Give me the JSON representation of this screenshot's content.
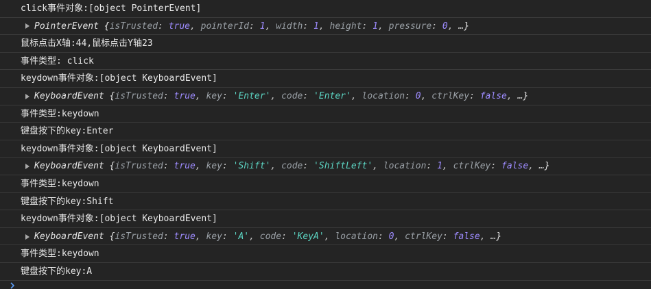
{
  "rows": [
    {
      "type": "text",
      "text": "click事件对象:[object PointerEvent]"
    },
    {
      "type": "object",
      "name": "PointerEvent",
      "props": [
        {
          "key": "isTrusted",
          "value": "true",
          "kind": "bool"
        },
        {
          "key": "pointerId",
          "value": "1",
          "kind": "num"
        },
        {
          "key": "width",
          "value": "1",
          "kind": "num"
        },
        {
          "key": "height",
          "value": "1",
          "kind": "num"
        },
        {
          "key": "pressure",
          "value": "0",
          "kind": "num"
        }
      ],
      "ellipsis": "…"
    },
    {
      "type": "text",
      "text": "鼠标点击X轴:44,鼠标点击Y轴23"
    },
    {
      "type": "text",
      "text": "事件类型: click"
    },
    {
      "type": "text",
      "text": "keydown事件对象:[object KeyboardEvent]"
    },
    {
      "type": "object",
      "name": "KeyboardEvent",
      "props": [
        {
          "key": "isTrusted",
          "value": "true",
          "kind": "bool"
        },
        {
          "key": "key",
          "value": "'Enter'",
          "kind": "str"
        },
        {
          "key": "code",
          "value": "'Enter'",
          "kind": "str"
        },
        {
          "key": "location",
          "value": "0",
          "kind": "num"
        },
        {
          "key": "ctrlKey",
          "value": "false",
          "kind": "bool"
        }
      ],
      "ellipsis": "…"
    },
    {
      "type": "text",
      "text": "事件类型:keydown"
    },
    {
      "type": "text",
      "text": "键盘按下的key:Enter"
    },
    {
      "type": "text",
      "text": "keydown事件对象:[object KeyboardEvent]"
    },
    {
      "type": "object",
      "name": "KeyboardEvent",
      "props": [
        {
          "key": "isTrusted",
          "value": "true",
          "kind": "bool"
        },
        {
          "key": "key",
          "value": "'Shift'",
          "kind": "str"
        },
        {
          "key": "code",
          "value": "'ShiftLeft'",
          "kind": "str"
        },
        {
          "key": "location",
          "value": "1",
          "kind": "num"
        },
        {
          "key": "ctrlKey",
          "value": "false",
          "kind": "bool"
        }
      ],
      "ellipsis": "…"
    },
    {
      "type": "text",
      "text": "事件类型:keydown"
    },
    {
      "type": "text",
      "text": "键盘按下的key:Shift"
    },
    {
      "type": "text",
      "text": "keydown事件对象:[object KeyboardEvent]"
    },
    {
      "type": "object",
      "name": "KeyboardEvent",
      "props": [
        {
          "key": "isTrusted",
          "value": "true",
          "kind": "bool"
        },
        {
          "key": "key",
          "value": "'A'",
          "kind": "str"
        },
        {
          "key": "code",
          "value": "'KeyA'",
          "kind": "str"
        },
        {
          "key": "location",
          "value": "0",
          "kind": "num"
        },
        {
          "key": "ctrlKey",
          "value": "false",
          "kind": "bool"
        }
      ],
      "ellipsis": "…"
    },
    {
      "type": "text",
      "text": "事件类型:keydown"
    },
    {
      "type": "text",
      "text": "键盘按下的key:A"
    }
  ],
  "icons": {
    "expand": "caret-right-icon",
    "prompt": "prompt-chevron-icon"
  },
  "colors": {
    "background": "#242424",
    "divider": "#3a3a3a",
    "text": "#e8e8e8",
    "bool_num": "#9e8cff",
    "string": "#5cd5c3",
    "key": "#9aa0a6"
  }
}
